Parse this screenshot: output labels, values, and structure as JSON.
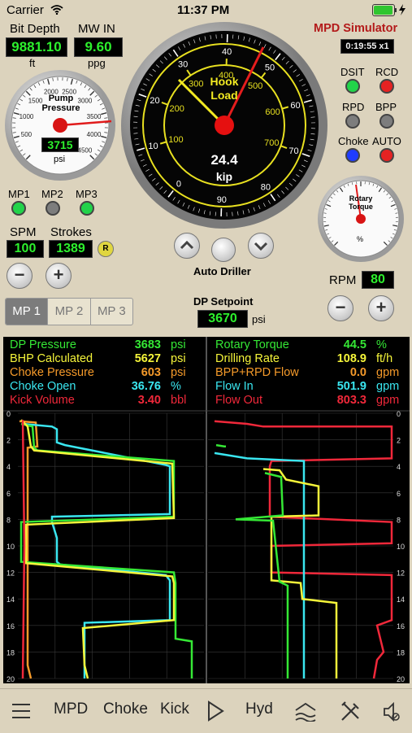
{
  "status": {
    "carrier": "Carrier",
    "time": "11:37 PM"
  },
  "header": {
    "title": "MPD Simulator",
    "timer": "0:19:55 x1"
  },
  "bit_depth": {
    "label": "Bit Depth",
    "value": "9881.10",
    "unit": "ft"
  },
  "mw_in": {
    "label": "MW IN",
    "value": "9.60",
    "unit": "ppg"
  },
  "pump_pressure": {
    "title": "Pump Pressure",
    "value": "3715",
    "unit": "psi",
    "ticks": [
      "500",
      "1000",
      "1500",
      "2000",
      "2500",
      "3000",
      "3500",
      "4000",
      "4500"
    ]
  },
  "hook_load": {
    "title": "Hook Load",
    "value": "24.4",
    "unit": "kip",
    "outer_ticks": [
      "0",
      "10",
      "20",
      "30",
      "40",
      "50",
      "60",
      "70",
      "80",
      "90"
    ],
    "inner_ticks": [
      "100",
      "200",
      "300",
      "400",
      "500",
      "600",
      "700"
    ]
  },
  "rotary_torque": {
    "title": "Rotary Torque",
    "unit": "%"
  },
  "indicators": {
    "dsit": "DSIT",
    "rcd": "RCD",
    "rpd": "RPD",
    "bpp": "BPP",
    "choke": "Choke",
    "auto": "AUTO",
    "colors": {
      "dsit": "#22d34a",
      "rcd": "#e52222",
      "rpd": "#7d7d7d",
      "bpp": "#7d7d7d",
      "choke": "#1f3cff",
      "auto": "#e52222"
    }
  },
  "mud_pumps": {
    "mp1": "MP1",
    "mp2": "MP2",
    "mp3": "MP3",
    "colors": {
      "mp1": "#22d34a",
      "mp2": "#7d7d7d",
      "mp3": "#22d34a"
    }
  },
  "spm": {
    "label": "SPM",
    "value": "100"
  },
  "strokes": {
    "label": "Strokes",
    "value": "1389",
    "reset": "R"
  },
  "auto_driller": {
    "label": "Auto Driller"
  },
  "rpm": {
    "label": "RPM",
    "value": "80"
  },
  "tabs": [
    "MP 1",
    "MP 2",
    "MP 3"
  ],
  "dp_setpoint": {
    "label": "DP Setpoint",
    "value": "3670",
    "unit": "psi"
  },
  "readouts_left": [
    {
      "name": "DP Pressure",
      "value": "3683",
      "unit": "psi",
      "color": "#35e835"
    },
    {
      "name": "BHP Calculated",
      "value": "5627",
      "unit": "psi",
      "color": "#f5f53a"
    },
    {
      "name": "Choke Pressure",
      "value": "603",
      "unit": "psi",
      "color": "#f59a2a"
    },
    {
      "name": "Choke Open",
      "value": "36.76",
      "unit": "%",
      "color": "#3ae6f0"
    },
    {
      "name": "Kick Volume",
      "value": "3.40",
      "unit": "bbl",
      "color": "#f0283a"
    }
  ],
  "readouts_right": [
    {
      "name": "Rotary Torque",
      "value": "44.5",
      "unit": "%",
      "color": "#35e835"
    },
    {
      "name": "Drilling Rate",
      "value": "108.9",
      "unit": "ft/h",
      "color": "#f5f53a"
    },
    {
      "name": "BPP+RPD Flow",
      "value": "0.0",
      "unit": "gpm",
      "color": "#f59a2a"
    },
    {
      "name": "Flow In",
      "value": "501.9",
      "unit": "gpm",
      "color": "#3ae6f0"
    },
    {
      "name": "Flow Out",
      "value": "803.3",
      "unit": "gpm",
      "color": "#f0283a"
    }
  ],
  "chart_axis": [
    "0",
    "2",
    "4",
    "6",
    "8",
    "10",
    "12",
    "14",
    "16",
    "18",
    "20"
  ],
  "bottom_nav": {
    "mpd": "MPD",
    "choke": "Choke",
    "kick": "Kick",
    "hyd": "Hyd"
  }
}
